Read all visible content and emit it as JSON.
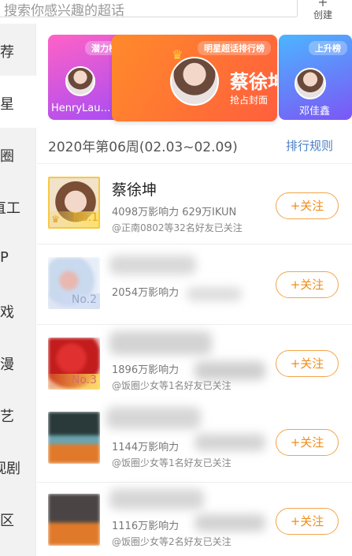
{
  "search": {
    "placeholder": "搜索你感兴趣的超话"
  },
  "create": {
    "icon": "plus-icon",
    "label": "创建"
  },
  "sidebar": {
    "items": [
      {
        "label": "荐"
      },
      {
        "label": "星"
      },
      {
        "label": "圈"
      },
      {
        "label": "直工"
      },
      {
        "label": "P"
      },
      {
        "label": "戏"
      },
      {
        "label": "漫"
      },
      {
        "label": "艺"
      },
      {
        "label": "视剧"
      },
      {
        "label": "区"
      }
    ]
  },
  "banner": {
    "left": {
      "tag": "潜力榜",
      "name": "HenryLau…"
    },
    "mid": {
      "tag": "明星超话排行榜",
      "name": "蔡徐坤",
      "sub": "抢占封面"
    },
    "right": {
      "tag": "上升榜",
      "name": "邓佳鑫"
    }
  },
  "week": {
    "title": "2020年第06周(02.03~02.09)",
    "rules_label": "排行规则"
  },
  "colors": {
    "accent": "#f08c1a",
    "link": "#4a7fc5",
    "badge": "#e9a21a"
  },
  "ranking": [
    {
      "rank": "No.1",
      "name": "蔡徐坤",
      "stats": "4098万影响力 629万IKUN",
      "friends": "@正南0802等32名好友已关注",
      "follow_label": "+关注"
    },
    {
      "rank": "No.2",
      "name": "",
      "stats": "2054万影响力",
      "friends": "",
      "follow_label": "+关注"
    },
    {
      "rank": "No.3",
      "name": "",
      "stats": "1896万影响力",
      "friends": "@饭圈少女等1名好友已关注",
      "follow_label": "+关注"
    },
    {
      "rank": "",
      "name": "",
      "stats": "1144万影响力",
      "friends": "@饭圈少女等1名好友已关注",
      "follow_label": "+关注"
    },
    {
      "rank": "",
      "name": "",
      "stats": "1116万影响力",
      "friends": "@饭圈少女等2名好友已关注",
      "follow_label": "+关注"
    }
  ]
}
